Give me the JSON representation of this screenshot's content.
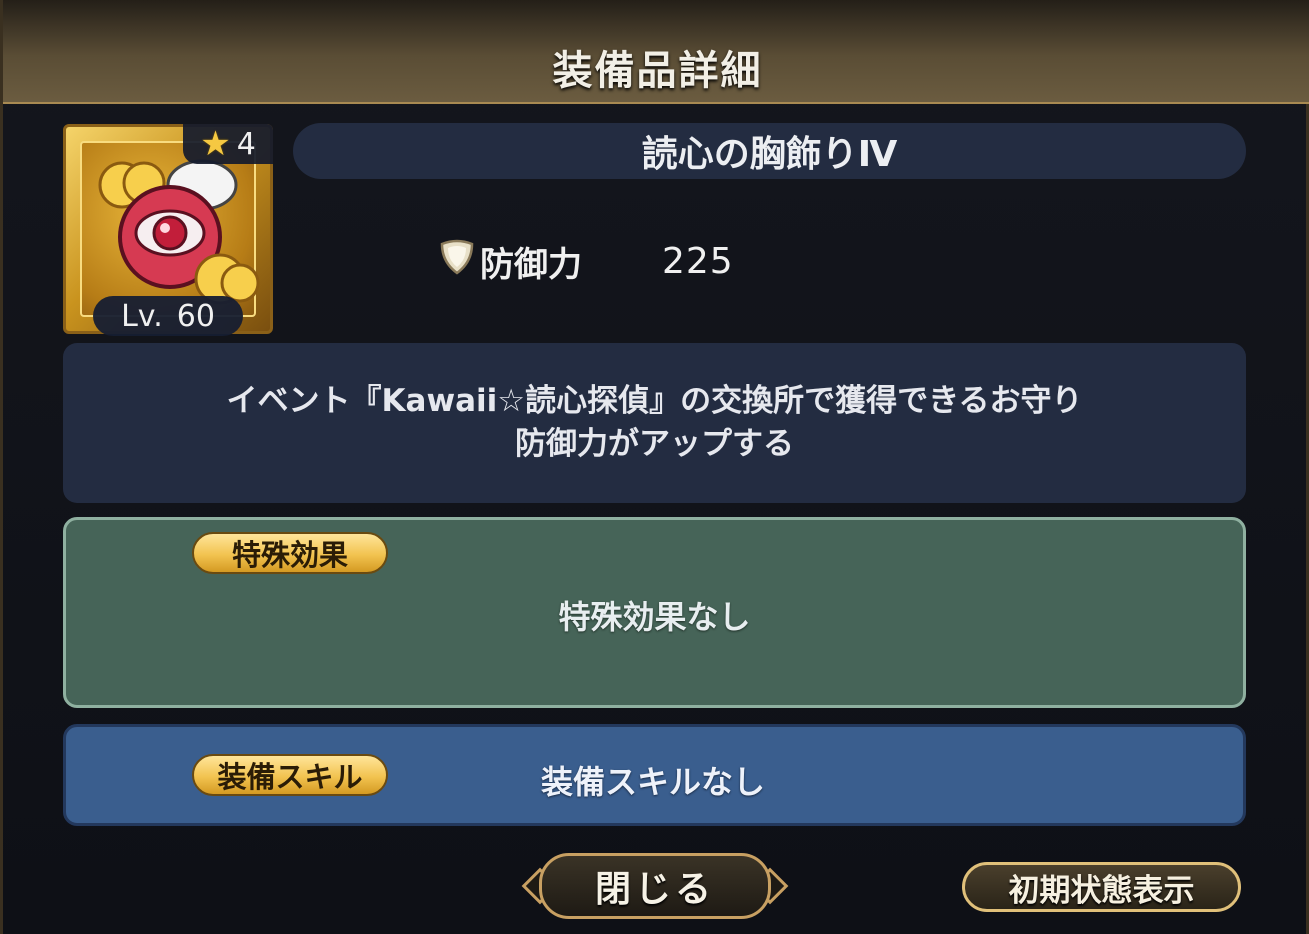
{
  "header": {
    "title": "装備品詳細"
  },
  "item": {
    "name": "読心の胸飾りⅣ",
    "rarity": "4",
    "level_prefix": "Lv.",
    "level": "60",
    "icon": "heart-eye-charm-icon"
  },
  "stats": {
    "defense_icon": "shield-icon",
    "defense_label": "防御力",
    "defense_value": "225"
  },
  "description": {
    "line1": "イベント『Kawaii☆読心探偵』の交換所で獲得できるお守り",
    "line2": "防御力がアップする"
  },
  "special_effect": {
    "label": "特殊効果",
    "text": "特殊効果なし"
  },
  "equip_skill": {
    "label": "装備スキル",
    "text": "装備スキルなし"
  },
  "buttons": {
    "close": "閉じる",
    "reset": "初期状態表示"
  },
  "colors": {
    "header_gold": "#a88a52",
    "name_bar": "#232c41",
    "effect_panel": "#466458",
    "skill_panel": "#3a5e8e",
    "pill_gold": "#f2c350"
  }
}
